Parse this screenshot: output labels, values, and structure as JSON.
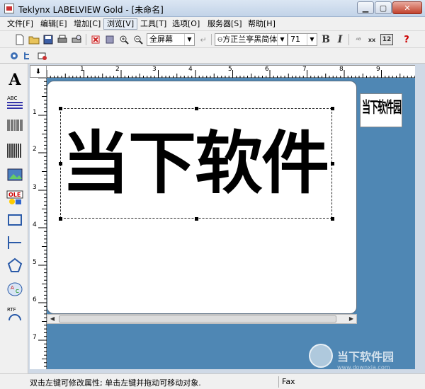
{
  "window": {
    "title": "Teklynx LABELVIEW Gold - [未命名]"
  },
  "menu": [
    {
      "label": "文件[F]"
    },
    {
      "label": "编辑[E]"
    },
    {
      "label": "增加[C]"
    },
    {
      "label": "浏览[V]"
    },
    {
      "label": "工具[T]"
    },
    {
      "label": "选项[O]"
    },
    {
      "label": "服务器[S]"
    },
    {
      "label": "帮助[H]"
    }
  ],
  "toolbar": {
    "zoom_value": "全屏幕",
    "font_name": "方正兰亭黑简体",
    "font_size": "71",
    "bold_label": "B",
    "italic_label": "I",
    "size_12_label": "12",
    "help_label": "?"
  },
  "ruler": {
    "top_ticks": [
      "1",
      "2",
      "3",
      "4",
      "5",
      "6",
      "7",
      "8",
      "9"
    ],
    "left_ticks": [
      "1",
      "2",
      "3",
      "4",
      "5",
      "6",
      "7"
    ]
  },
  "label": {
    "text": "当下软件园",
    "thumbnail_text": "当下软件园"
  },
  "watermark": {
    "text": "当下软件园",
    "url": "www.downxia.com"
  },
  "status": {
    "hint": "双击左键可修改属性; 单击左键并拖动可移动对象.",
    "fax": "Fax"
  },
  "colors": {
    "workspace": "#4f87b4",
    "title_bg": "#c2d3e8"
  }
}
